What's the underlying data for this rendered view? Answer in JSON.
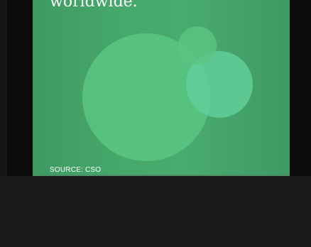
{
  "slide": {
    "headline": "worldwide.",
    "source": "SOURCE: CSO"
  },
  "icons": {
    "corner": "expand-icon"
  }
}
